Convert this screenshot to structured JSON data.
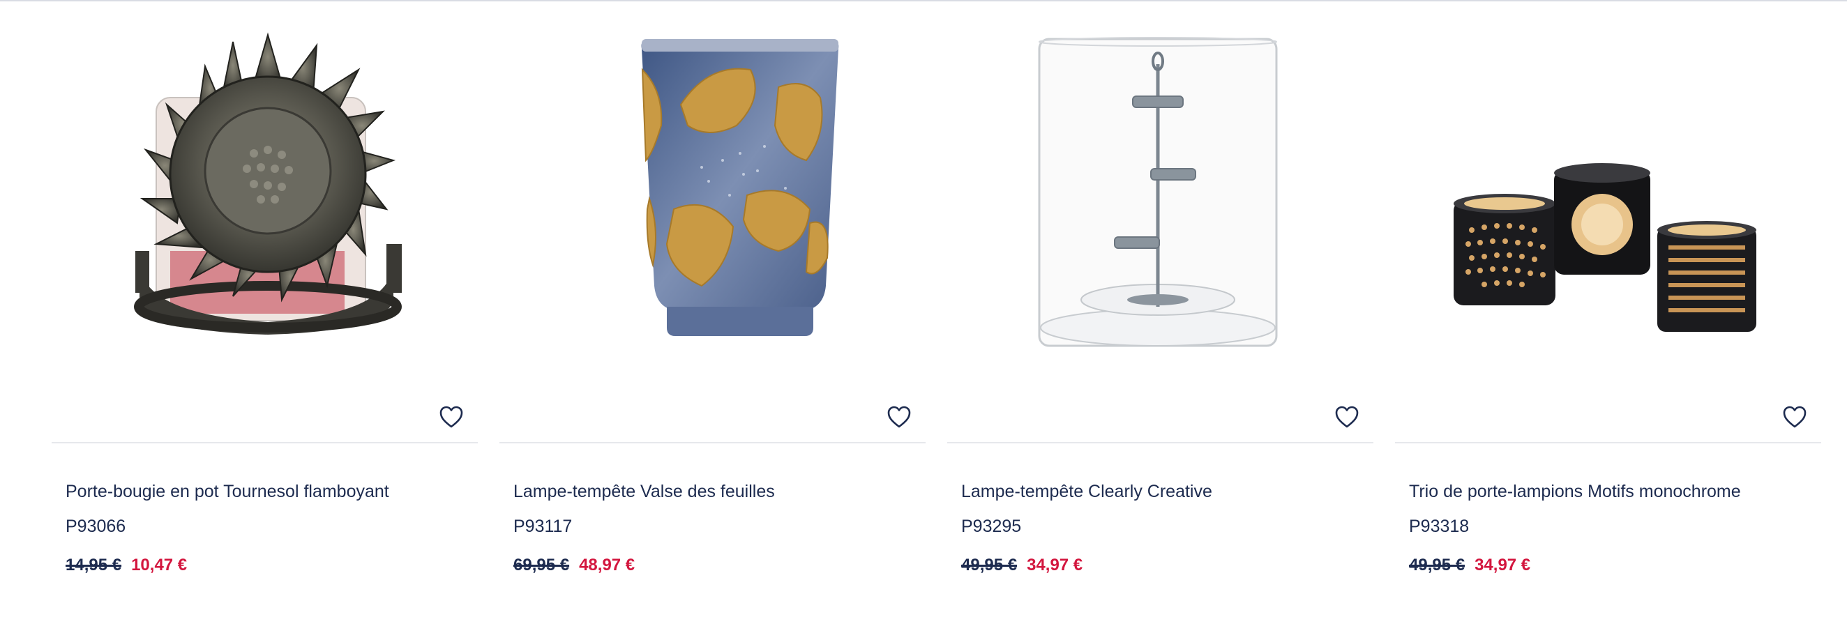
{
  "colors": {
    "text": "#1d2b4f",
    "sale": "#d3163e",
    "divider": "#e6e8ec"
  },
  "products": [
    {
      "name": "Porte-bougie en pot Tournesol flamboyant",
      "ref": "P93066",
      "old_price": "14,95 €",
      "new_price": "10,47 €",
      "image_icon": "sunflower-candle-holder"
    },
    {
      "name": "Lampe-tempête Valse des feuilles",
      "ref": "P93117",
      "old_price": "69,95 €",
      "new_price": "48,97 €",
      "image_icon": "blue-leaf-hurricane"
    },
    {
      "name": "Lampe-tempête Clearly Creative",
      "ref": "P93295",
      "old_price": "49,95 €",
      "new_price": "34,97 €",
      "image_icon": "clear-glass-hurricane"
    },
    {
      "name": "Trio de porte-lampions Motifs monochrome",
      "ref": "P93318",
      "old_price": "49,95 €",
      "new_price": "34,97 €",
      "image_icon": "votive-trio"
    }
  ]
}
